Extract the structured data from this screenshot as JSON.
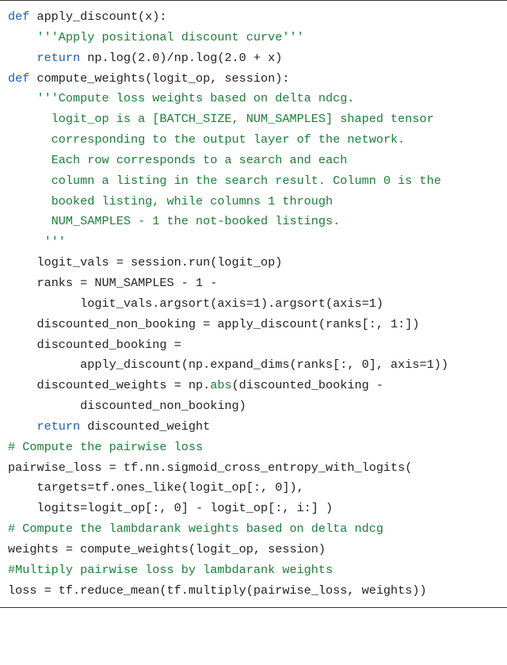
{
  "code": {
    "lines": [
      {
        "indent": 0,
        "spans": [
          {
            "c": "kw",
            "t": "def"
          },
          {
            "c": "plain",
            "t": " apply_discount(x):"
          }
        ]
      },
      {
        "indent": 1,
        "spans": [
          {
            "c": "str",
            "t": "'''Apply positional discount curve'''"
          }
        ]
      },
      {
        "indent": 1,
        "spans": [
          {
            "c": "kw",
            "t": "return"
          },
          {
            "c": "plain",
            "t": " np.log(2.0)/np.log(2.0 + x)"
          }
        ]
      },
      {
        "indent": 0,
        "spans": [
          {
            "c": "plain",
            "t": ""
          }
        ]
      },
      {
        "indent": 0,
        "spans": [
          {
            "c": "kw",
            "t": "def"
          },
          {
            "c": "plain",
            "t": " compute_weights(logit_op, session):"
          }
        ]
      },
      {
        "indent": 1,
        "spans": [
          {
            "c": "str",
            "t": "'''Compute loss weights based on delta ndcg."
          }
        ]
      },
      {
        "indent": 1,
        "spans": [
          {
            "c": "str",
            "t": "  logit_op is a [BATCH_SIZE, NUM_SAMPLES] shaped tensor"
          }
        ]
      },
      {
        "indent": 1,
        "spans": [
          {
            "c": "str",
            "t": "  corresponding to the output layer of the network."
          }
        ]
      },
      {
        "indent": 1,
        "spans": [
          {
            "c": "str",
            "t": "  Each row corresponds to a search and each"
          }
        ]
      },
      {
        "indent": 1,
        "spans": [
          {
            "c": "str",
            "t": "  column a listing in the search result. Column 0 is the"
          }
        ]
      },
      {
        "indent": 1,
        "spans": [
          {
            "c": "str",
            "t": "  booked listing, while columns 1 through"
          }
        ]
      },
      {
        "indent": 1,
        "spans": [
          {
            "c": "str",
            "t": "  NUM_SAMPLES - 1 the not-booked listings."
          }
        ]
      },
      {
        "indent": 1,
        "spans": [
          {
            "c": "str",
            "t": " '''"
          }
        ]
      },
      {
        "indent": 1,
        "spans": [
          {
            "c": "plain",
            "t": "logit_vals = session.run(logit_op)"
          }
        ]
      },
      {
        "indent": 1,
        "spans": [
          {
            "c": "plain",
            "t": "ranks = NUM_SAMPLES - 1 -"
          }
        ]
      },
      {
        "indent": 2,
        "spans": [
          {
            "c": "plain",
            "t": "  logit_vals.argsort(axis=1).argsort(axis=1)"
          }
        ]
      },
      {
        "indent": 1,
        "spans": [
          {
            "c": "plain",
            "t": "discounted_non_booking = apply_discount(ranks[:, 1:])"
          }
        ]
      },
      {
        "indent": 1,
        "spans": [
          {
            "c": "plain",
            "t": "discounted_booking ="
          }
        ]
      },
      {
        "indent": 2,
        "spans": [
          {
            "c": "plain",
            "t": "  apply_discount(np.expand_dims(ranks[:, 0], axis=1))"
          }
        ]
      },
      {
        "indent": 1,
        "spans": [
          {
            "c": "plain",
            "t": "discounted_weights = np."
          },
          {
            "c": "builtin",
            "t": "abs"
          },
          {
            "c": "plain",
            "t": "(discounted_booking -"
          }
        ]
      },
      {
        "indent": 2,
        "spans": [
          {
            "c": "plain",
            "t": "  discounted_non_booking)"
          }
        ]
      },
      {
        "indent": 1,
        "spans": [
          {
            "c": "kw",
            "t": "return"
          },
          {
            "c": "plain",
            "t": " discounted_weight"
          }
        ]
      },
      {
        "indent": 0,
        "spans": [
          {
            "c": "plain",
            "t": ""
          }
        ]
      },
      {
        "indent": 0,
        "spans": [
          {
            "c": "com",
            "t": "# Compute the pairwise loss"
          }
        ]
      },
      {
        "indent": 0,
        "spans": [
          {
            "c": "plain",
            "t": "pairwise_loss = tf.nn.sigmoid_cross_entropy_with_logits("
          }
        ]
      },
      {
        "indent": 1,
        "spans": [
          {
            "c": "plain",
            "t": "targets=tf.ones_like(logit_op[:, 0]),"
          }
        ]
      },
      {
        "indent": 1,
        "spans": [
          {
            "c": "plain",
            "t": "logits=logit_op[:, 0] - logit_op[:, i:] )"
          }
        ]
      },
      {
        "indent": 0,
        "spans": [
          {
            "c": "com",
            "t": "# Compute the lambdarank weights based on delta ndcg"
          }
        ]
      },
      {
        "indent": 0,
        "spans": [
          {
            "c": "plain",
            "t": "weights = compute_weights(logit_op, session)"
          }
        ]
      },
      {
        "indent": 0,
        "spans": [
          {
            "c": "com",
            "t": "#Multiply pairwise loss by lambdarank weights"
          }
        ]
      },
      {
        "indent": 0,
        "spans": [
          {
            "c": "plain",
            "t": "loss = tf.reduce_mean(tf.multiply(pairwise_loss, weights))"
          }
        ]
      }
    ]
  }
}
